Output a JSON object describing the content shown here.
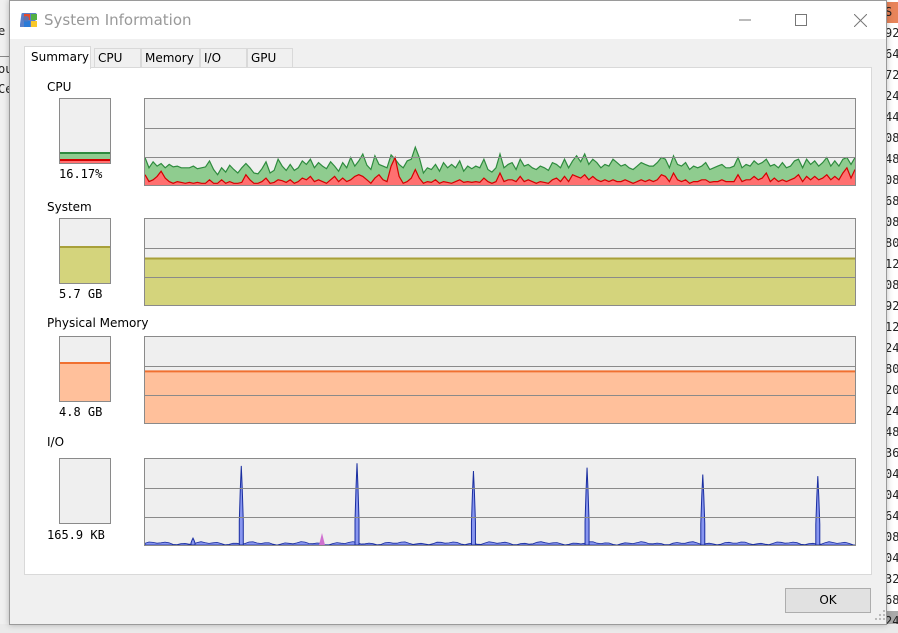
{
  "window": {
    "title": "System Information",
    "icon": "windows-app-icon",
    "controls": {
      "minimize": "minimize-icon",
      "maximize": "maximize-icon",
      "close": "close-icon"
    }
  },
  "tabs": [
    {
      "label": "Summary",
      "active": true
    },
    {
      "label": "CPU",
      "active": false
    },
    {
      "label": "Memory",
      "active": false
    },
    {
      "label": "I/O",
      "active": false
    },
    {
      "label": "GPU",
      "active": false
    }
  ],
  "sections": {
    "cpu": {
      "label": "CPU",
      "value": "16.17%",
      "fraction": 0.1617,
      "kernel_fraction": 0.05
    },
    "system": {
      "label": "System",
      "value": "5.7 GB",
      "fraction": 0.57
    },
    "physical_memory": {
      "label": "Physical Memory",
      "value": "4.8 GB",
      "fraction": 0.6
    },
    "io": {
      "label": "I/O",
      "value": "165.9  KB",
      "fraction": 0.0
    }
  },
  "colors": {
    "cpu_total_fill": "#8fcc8f",
    "cpu_total_line": "#2e8b3e",
    "cpu_kernel_fill": "#ff7070",
    "cpu_kernel_line": "#d40000",
    "system_fill": "#d4d47c",
    "system_line": "#a8a03a",
    "memory_fill": "#ffc09b",
    "memory_line": "#f07030",
    "io_fill": "#8896f0",
    "io_line": "#1a2ea0",
    "io_other": "#d070d0"
  },
  "history": {
    "cpu_total": [
      0.32,
      0.2,
      0.27,
      0.22,
      0.25,
      0.2,
      0.24,
      0.21,
      0.22,
      0.2,
      0.2,
      0.2,
      0.22,
      0.19,
      0.2,
      0.21,
      0.28,
      0.18,
      0.12,
      0.2,
      0.15,
      0.23,
      0.18,
      0.14,
      0.2,
      0.25,
      0.2,
      0.14,
      0.13,
      0.19,
      0.27,
      0.14,
      0.17,
      0.3,
      0.22,
      0.17,
      0.24,
      0.17,
      0.2,
      0.28,
      0.24,
      0.3,
      0.2,
      0.26,
      0.22,
      0.19,
      0.27,
      0.22,
      0.16,
      0.26,
      0.2,
      0.32,
      0.22,
      0.28,
      0.36,
      0.23,
      0.18,
      0.34,
      0.24,
      0.22,
      0.2,
      0.35,
      0.3,
      0.24,
      0.2,
      0.28,
      0.3,
      0.44,
      0.32,
      0.14,
      0.2,
      0.18,
      0.24,
      0.16,
      0.26,
      0.2,
      0.24,
      0.2,
      0.28,
      0.16,
      0.22,
      0.19,
      0.22,
      0.2,
      0.3,
      0.18,
      0.15,
      0.2,
      0.36,
      0.2,
      0.24,
      0.26,
      0.18,
      0.3,
      0.22,
      0.24,
      0.2,
      0.18,
      0.22,
      0.2,
      0.17,
      0.26,
      0.24,
      0.2,
      0.3,
      0.2,
      0.28,
      0.34,
      0.27,
      0.36,
      0.24,
      0.3,
      0.26,
      0.2,
      0.24,
      0.22,
      0.3,
      0.26,
      0.22,
      0.24,
      0.2,
      0.18,
      0.22,
      0.26,
      0.24,
      0.22,
      0.22,
      0.26,
      0.32,
      0.3,
      0.2,
      0.34,
      0.24,
      0.22,
      0.26,
      0.18,
      0.22,
      0.2,
      0.22,
      0.26,
      0.18,
      0.2,
      0.22,
      0.24,
      0.2,
      0.2,
      0.22,
      0.32,
      0.2,
      0.24,
      0.22,
      0.28,
      0.24,
      0.26,
      0.3,
      0.22,
      0.24,
      0.2,
      0.26,
      0.2,
      0.22,
      0.28,
      0.3,
      0.2,
      0.3,
      0.24,
      0.28,
      0.22,
      0.26,
      0.32,
      0.22,
      0.28,
      0.22,
      0.3,
      0.32,
      0.24,
      0.32
    ],
    "cpu_kernel": [
      0.12,
      0.04,
      0.06,
      0.1,
      0.16,
      0.08,
      0.04,
      0.02,
      0.04,
      0.03,
      0.02,
      0.03,
      0.02,
      0.03,
      0.02,
      0.02,
      0.06,
      0.02,
      0.02,
      0.06,
      0.02,
      0.04,
      0.02,
      0.02,
      0.03,
      0.12,
      0.06,
      0.02,
      0.02,
      0.04,
      0.08,
      0.02,
      0.03,
      0.06,
      0.05,
      0.03,
      0.06,
      0.02,
      0.04,
      0.08,
      0.06,
      0.1,
      0.04,
      0.06,
      0.04,
      0.02,
      0.06,
      0.1,
      0.04,
      0.08,
      0.04,
      0.06,
      0.1,
      0.12,
      0.1,
      0.06,
      0.02,
      0.08,
      0.12,
      0.06,
      0.04,
      0.22,
      0.32,
      0.1,
      0.02,
      0.04,
      0.08,
      0.18,
      0.08,
      0.02,
      0.04,
      0.03,
      0.06,
      0.02,
      0.04,
      0.03,
      0.02,
      0.04,
      0.06,
      0.03,
      0.04,
      0.03,
      0.04,
      0.03,
      0.08,
      0.04,
      0.02,
      0.04,
      0.14,
      0.04,
      0.06,
      0.06,
      0.04,
      0.1,
      0.04,
      0.06,
      0.04,
      0.02,
      0.04,
      0.03,
      0.02,
      0.06,
      0.08,
      0.04,
      0.1,
      0.04,
      0.12,
      0.1,
      0.08,
      0.12,
      0.06,
      0.1,
      0.06,
      0.04,
      0.06,
      0.04,
      0.06,
      0.04,
      0.04,
      0.06,
      0.04,
      0.02,
      0.04,
      0.06,
      0.04,
      0.06,
      0.04,
      0.06,
      0.12,
      0.1,
      0.04,
      0.14,
      0.06,
      0.04,
      0.06,
      0.02,
      0.04,
      0.04,
      0.06,
      0.06,
      0.03,
      0.04,
      0.04,
      0.06,
      0.04,
      0.04,
      0.04,
      0.12,
      0.04,
      0.06,
      0.06,
      0.1,
      0.06,
      0.08,
      0.14,
      0.04,
      0.08,
      0.04,
      0.06,
      0.04,
      0.06,
      0.08,
      0.12,
      0.04,
      0.1,
      0.06,
      0.1,
      0.06,
      0.08,
      0.12,
      0.06,
      0.1,
      0.06,
      0.14,
      0.2,
      0.08,
      0.18
    ],
    "system": 0.54,
    "physical_memory": 0.6,
    "io_spikes": [
      0.08,
      0.92,
      0.95,
      0.86,
      0.9,
      0.82,
      0.8
    ],
    "io_spike_positions": [
      0.0,
      0.068,
      0.231,
      0.395,
      0.555,
      0.718,
      0.88
    ]
  },
  "buttons": {
    "ok": "OK"
  },
  "background": {
    "left_text": [
      "e",
      "ou",
      "Ce"
    ],
    "right_cells": [
      "S",
      "92",
      "64",
      "72",
      "24",
      "44",
      "08",
      "48",
      "08",
      "68",
      "08",
      "80",
      "12",
      "08",
      "92",
      "12",
      "24",
      "80",
      "20",
      "24",
      "48",
      "36",
      "04",
      "04",
      "64",
      "08",
      "04",
      "32",
      "68",
      "24"
    ]
  }
}
